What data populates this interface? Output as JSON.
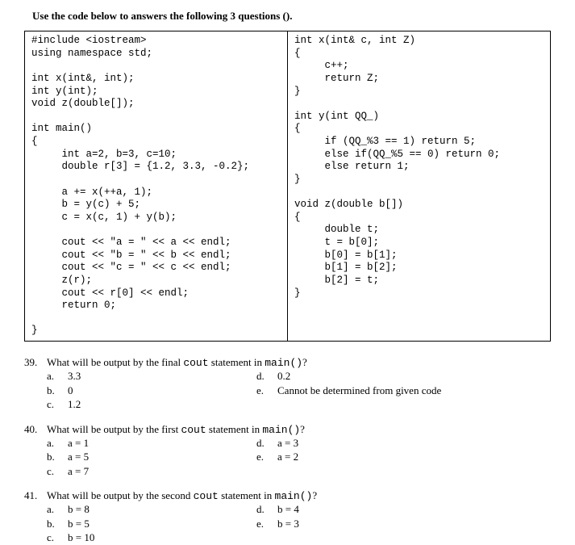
{
  "instruction": "Use the code below to answers the following 3 questions ().",
  "code": {
    "left": "#include <iostream>\nusing namespace std;\n\nint x(int&, int);\nint y(int);\nvoid z(double[]);\n\nint main()\n{\n     int a=2, b=3, c=10;\n     double r[3] = {1.2, 3.3, -0.2};\n\n     a += x(++a, 1);\n     b = y(c) + 5;\n     c = x(c, 1) + y(b);\n\n     cout << \"a = \" << a << endl;\n     cout << \"b = \" << b << endl;\n     cout << \"c = \" << c << endl;\n     z(r);\n     cout << r[0] << endl;\n     return 0;\n\n}",
    "right": "int x(int& c, int Z)\n{\n     c++;\n     return Z;\n}\n\nint y(int QQ_)\n{\n     if (QQ_%3 == 1) return 5;\n     else if(QQ_%5 == 0) return 0;\n     else return 1;\n}\n\nvoid z(double b[])\n{\n     double t;\n     t = b[0];\n     b[0] = b[1];\n     b[1] = b[2];\n     b[2] = t;\n}"
  },
  "questions": [
    {
      "num": "39.",
      "pre": "What will be output by the final ",
      "mono": "cout",
      "mid": " statement in ",
      "mono2": "main()",
      "post": "?",
      "left": [
        {
          "l": "a.",
          "v": "3.3"
        },
        {
          "l": "b.",
          "v": "0"
        },
        {
          "l": "c.",
          "v": "1.2"
        }
      ],
      "right": [
        {
          "l": "d.",
          "v": "0.2"
        },
        {
          "l": "e.",
          "v": "Cannot be determined from given code"
        }
      ]
    },
    {
      "num": "40.",
      "pre": "What will be output by the first ",
      "mono": "cout",
      "mid": " statement in ",
      "mono2": "main()",
      "post": "?",
      "left": [
        {
          "l": "a.",
          "v": "a = 1"
        },
        {
          "l": "b.",
          "v": "a = 5"
        },
        {
          "l": "c.",
          "v": "a = 7"
        }
      ],
      "right": [
        {
          "l": "d.",
          "v": "a = 3"
        },
        {
          "l": "e.",
          "v": "a = 2"
        }
      ]
    },
    {
      "num": "41.",
      "pre": "What will be output by the second ",
      "mono": "cout",
      "mid": " statement in ",
      "mono2": "main()",
      "post": "?",
      "left": [
        {
          "l": "a.",
          "v": "b = 8"
        },
        {
          "l": "b.",
          "v": "b = 5"
        },
        {
          "l": "c.",
          "v": "b = 10"
        }
      ],
      "right": [
        {
          "l": "d.",
          "v": "b = 4"
        },
        {
          "l": "e.",
          "v": "b = 3"
        }
      ]
    }
  ]
}
